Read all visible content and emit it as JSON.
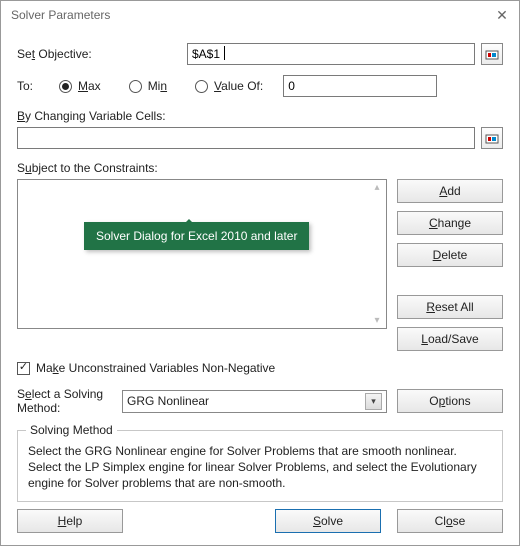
{
  "window": {
    "title": "Solver Parameters"
  },
  "objective": {
    "label_pre": "Se",
    "label_u": "t",
    "label_post": " Objective:",
    "value": "$A$1"
  },
  "to": {
    "label": "To:",
    "max_u": "M",
    "max_post": "ax",
    "min_pre": "Mi",
    "min_u": "n",
    "valueof_u": "V",
    "valueof_post": "alue Of:",
    "selected": "max",
    "value_of_value": "0"
  },
  "varcells": {
    "label_u": "B",
    "label_post": "y Changing Variable Cells:",
    "value": ""
  },
  "constraints": {
    "label_pre": "S",
    "label_u": "u",
    "label_post": "bject to the Constraints:",
    "items": []
  },
  "buttons": {
    "add_u": "A",
    "add_post": "dd",
    "change_u": "C",
    "change_post": "hange",
    "delete_u": "D",
    "delete_post": "elete",
    "resetall_u": "R",
    "resetall_post": "eset All",
    "loadsave_u": "L",
    "loadsave_post": "oad/Save",
    "options_pre": "O",
    "options_u": "p",
    "options_post": "tions",
    "help_u": "H",
    "help_post": "elp",
    "solve_u": "S",
    "solve_post": "olve",
    "close_pre": "Cl",
    "close_u": "o",
    "close_post": "se"
  },
  "nonneg": {
    "label_pre": "Ma",
    "label_u": "k",
    "label_post": "e Unconstrained Variables Non-Negative",
    "checked": true
  },
  "method": {
    "label_pre": "S",
    "label_u": "e",
    "label_post": "lect a Solving",
    "label_line2": "Method:",
    "selected": "GRG Nonlinear"
  },
  "group": {
    "title": "Solving Method",
    "desc": "Select the GRG Nonlinear engine for Solver Problems that are smooth nonlinear. Select the LP Simplex engine for linear Solver Problems, and select the Evolutionary engine for Solver problems that are non-smooth."
  },
  "tooltip": {
    "text": "Solver Dialog for Excel 2010 and later"
  }
}
